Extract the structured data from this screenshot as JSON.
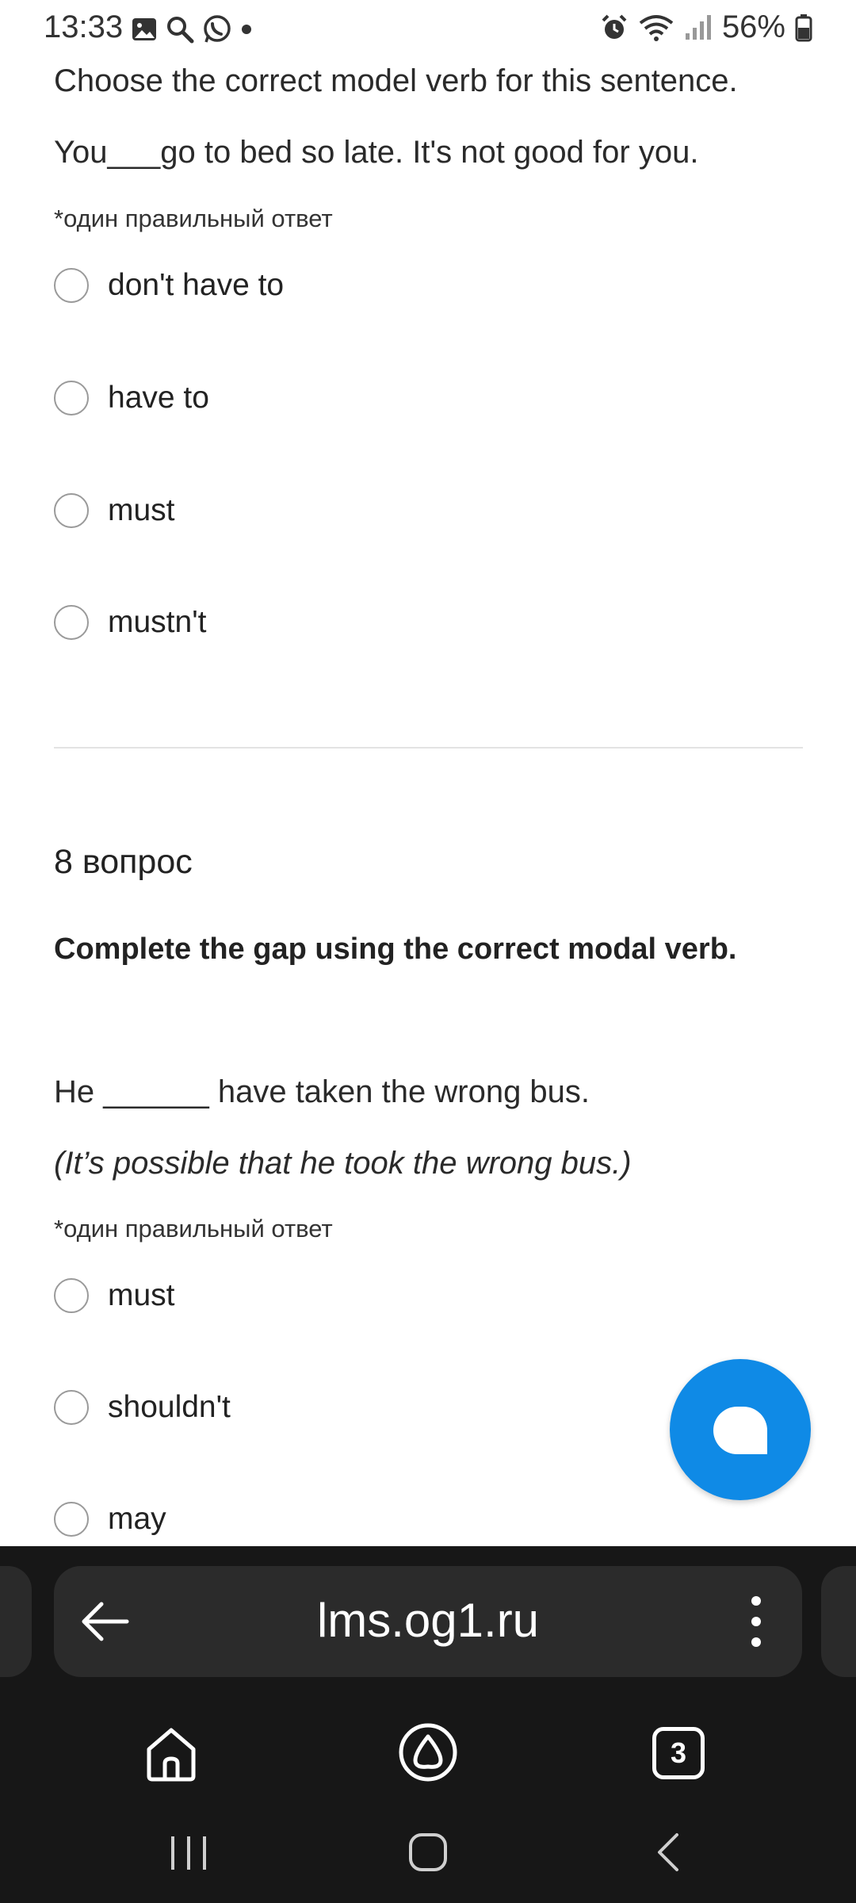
{
  "status_bar": {
    "time": "13:33",
    "battery": "56%"
  },
  "question7": {
    "prompt": "Choose the correct model verb for this sentence.",
    "sentence": "You___go to bed so late. It's not good for you.",
    "hint": "*один правильный ответ",
    "options": [
      "don't have to",
      "have to",
      "must",
      "mustn't"
    ]
  },
  "question8": {
    "number": "8 вопрос",
    "title": "Complete the gap using the correct modal verb.",
    "sentence": "He ______ have taken the wrong bus.",
    "note": "(It’s possible that he took the wrong bus.)",
    "hint": "*один правильный ответ",
    "options": [
      "must",
      "shouldn't",
      "may"
    ]
  },
  "browser": {
    "url": "lms.og1.ru",
    "tab_count": "3"
  },
  "colors": {
    "fab": "#0f8ae6",
    "browser_bg": "#171717",
    "urlbar_bg": "#2b2b2b"
  }
}
